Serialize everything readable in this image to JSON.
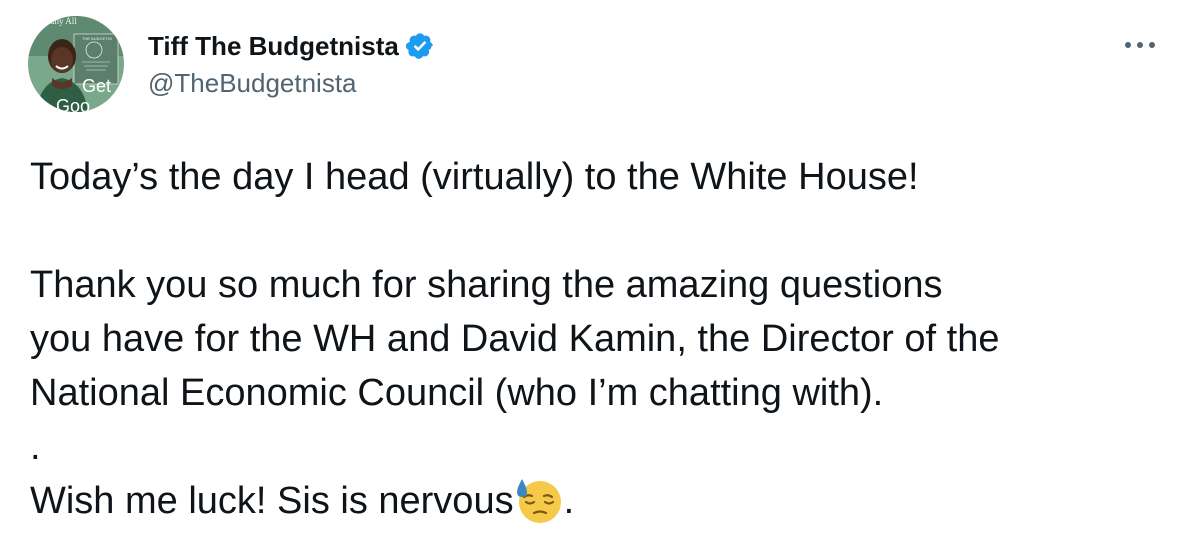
{
  "author": {
    "display_name": "Tiff The Budgetnista",
    "handle": "@TheBudgetnista",
    "verified": true,
    "avatar_text": {
      "top": "iany All",
      "book": "THE BUDGETNI",
      "get": "Get",
      "good": "Goo"
    }
  },
  "tweet": {
    "line1": "Today’s the day I head (virtually) to the White House!",
    "line2": "Thank you so much for sharing the amazing questions",
    "line3": "you have for the WH and David Kamin, the Director of the",
    "line4": "National Economic Council (who I’m chatting with).",
    "line5": ".",
    "line6": "Wish me luck! Sis is nervous",
    "line6_end": ".",
    "emoji": "downcast-face-with-sweat-emoji"
  },
  "icons": {
    "verified": "verified-badge-icon",
    "more": "more-options-icon"
  },
  "colors": {
    "verified_blue": "#1d9bf0",
    "text_primary": "#0f1419",
    "text_secondary": "#536471",
    "avatar_bg": "#7aa88c",
    "emoji_yellow": "#f7c948",
    "sweat_blue": "#3b88c3"
  }
}
